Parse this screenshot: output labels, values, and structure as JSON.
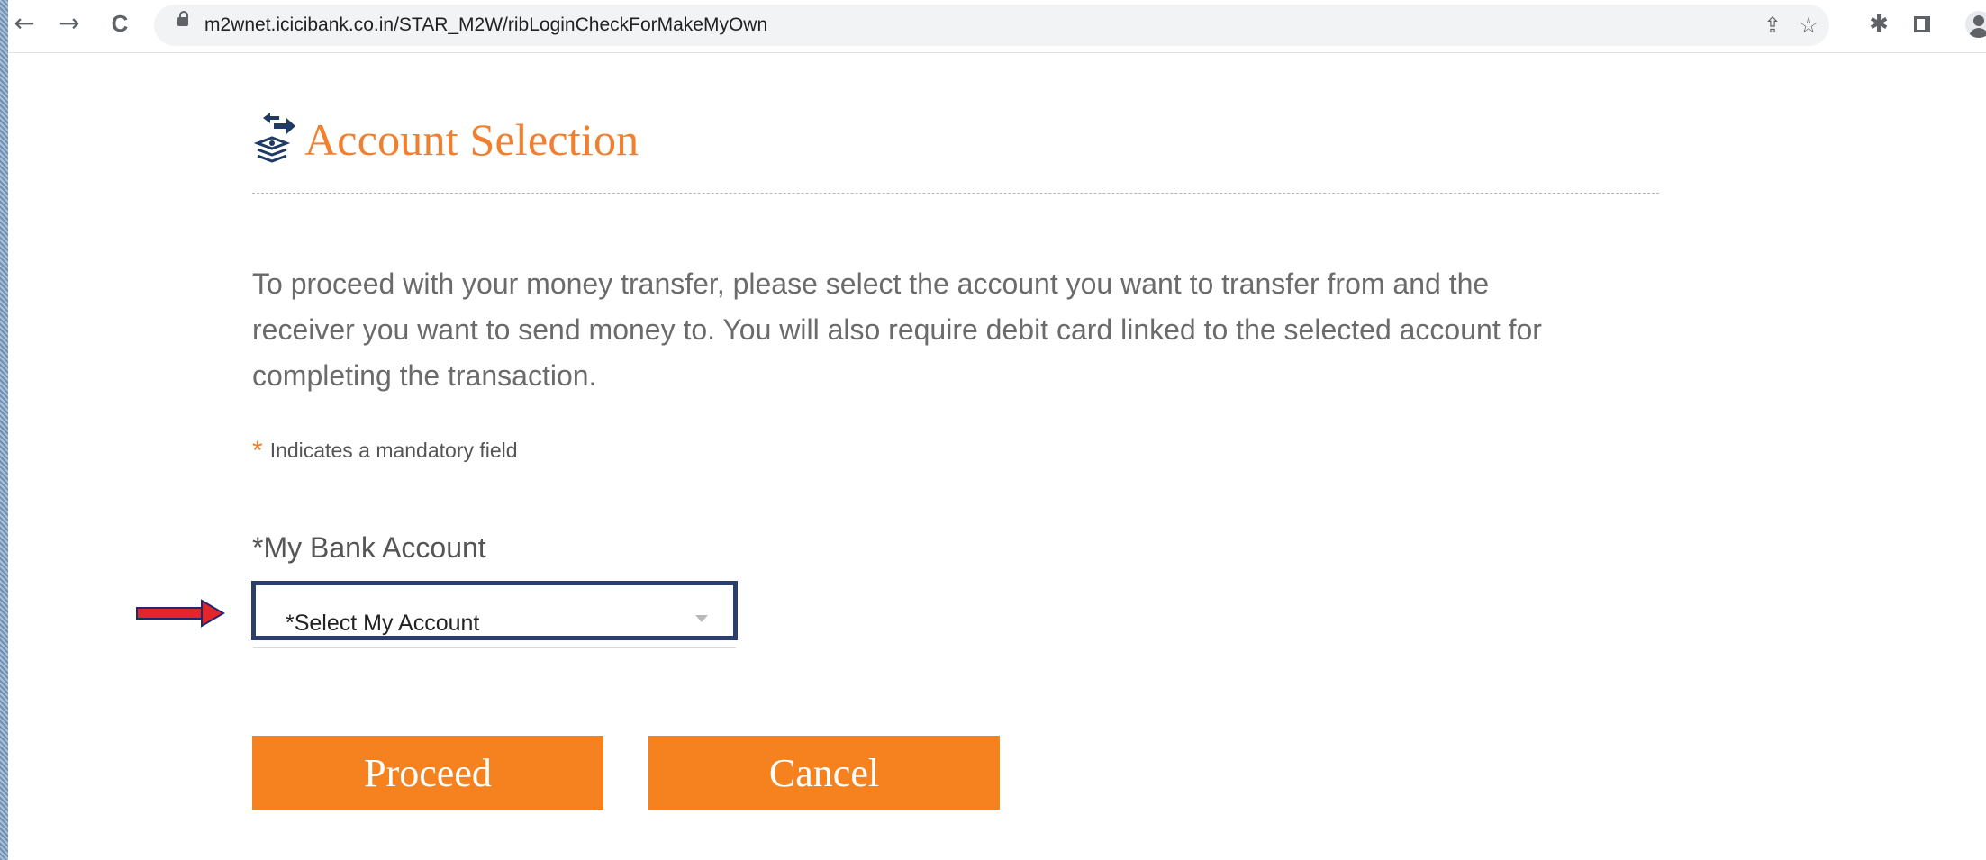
{
  "browser": {
    "url": "m2wnet.icicibank.co.in/STAR_M2W/ribLoginCheckForMakeMyOwn",
    "icons": {
      "back": "←",
      "forward": "→",
      "reload": "C",
      "share": "⇪",
      "bookmark": "☆",
      "extensions": "✱"
    }
  },
  "page": {
    "title": "Account Selection",
    "intro": "To proceed with your money transfer, please select the account you want to transfer from and the receiver you want to send money to. You will also require debit card linked to the selected account for completing the transaction.",
    "mandatory_marker": "*",
    "mandatory_note": "Indicates a mandatory field"
  },
  "form": {
    "account_label": "*My Bank Account",
    "account_select_value": "*Select My Account"
  },
  "buttons": {
    "proceed": "Proceed",
    "cancel": "Cancel"
  },
  "colors": {
    "accent_orange": "#f5821f",
    "title_orange": "#f08030",
    "select_border": "#2b3f6e",
    "annotation_arrow": "#e3262b"
  }
}
